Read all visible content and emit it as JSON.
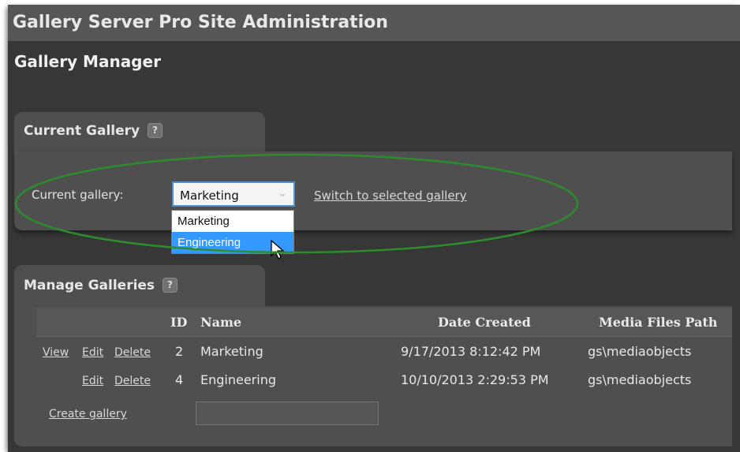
{
  "header": {
    "title": "Gallery Server Pro Site Administration"
  },
  "page": {
    "title": "Gallery Manager"
  },
  "current_gallery": {
    "section_title": "Current Gallery",
    "help_symbol": "?",
    "label": "Current gallery:",
    "selected_value": "Marketing",
    "options": [
      "Marketing",
      "Engineering"
    ],
    "highlighted_option": "Engineering",
    "switch_link": "Switch to selected gallery"
  },
  "manage": {
    "section_title": "Manage Galleries",
    "help_symbol": "?",
    "columns": {
      "id": "ID",
      "name": "Name",
      "date": "Date Created",
      "path": "Media Files Path"
    },
    "rows": [
      {
        "actions": [
          "View",
          "Edit",
          "Delete"
        ],
        "id": "2",
        "name": "Marketing",
        "date": "9/17/2013 8:12:42 PM",
        "path": "gs\\mediaobjects"
      },
      {
        "actions": [
          "Edit",
          "Delete"
        ],
        "id": "4",
        "name": "Engineering",
        "date": "10/10/2013 2:29:53 PM",
        "path": "gs\\mediaobjects"
      }
    ],
    "create_link": "Create gallery",
    "create_input_value": ""
  },
  "colors": {
    "background": "#373737",
    "header_bar": "#565656",
    "panel": "#4f4f4f",
    "highlight": "#3399ff",
    "annotation_ellipse": "#2e8b2e"
  }
}
